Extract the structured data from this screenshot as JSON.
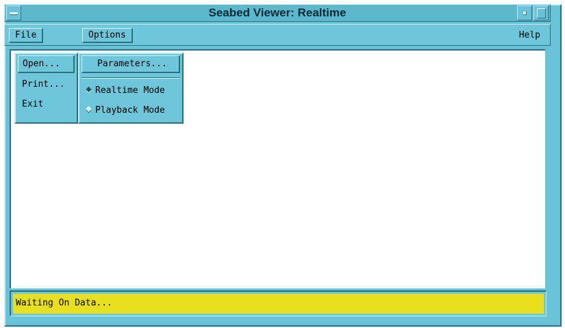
{
  "window": {
    "title": "Seabed Viewer: Realtime"
  },
  "menubar": {
    "file_label": "File",
    "options_label": "Options",
    "help_label": "Help"
  },
  "file_menu": {
    "items": [
      {
        "label": "Open...",
        "highlighted": true
      },
      {
        "label": "Print..."
      },
      {
        "label": "Exit"
      }
    ]
  },
  "options_menu": {
    "parameters_label": "Parameters...",
    "modes": [
      {
        "label": "Realtime Mode",
        "selected": true
      },
      {
        "label": "Playback Mode",
        "selected": false
      }
    ]
  },
  "status": {
    "text": "Waiting On Data..."
  },
  "colors": {
    "chrome": "#68c3d8",
    "status_background": "#e8df1e",
    "content_background": "#ffffff"
  },
  "icons": {
    "window_menu": "window-menu-icon",
    "minimize": "minimize-icon",
    "maximize": "maximize-icon"
  }
}
